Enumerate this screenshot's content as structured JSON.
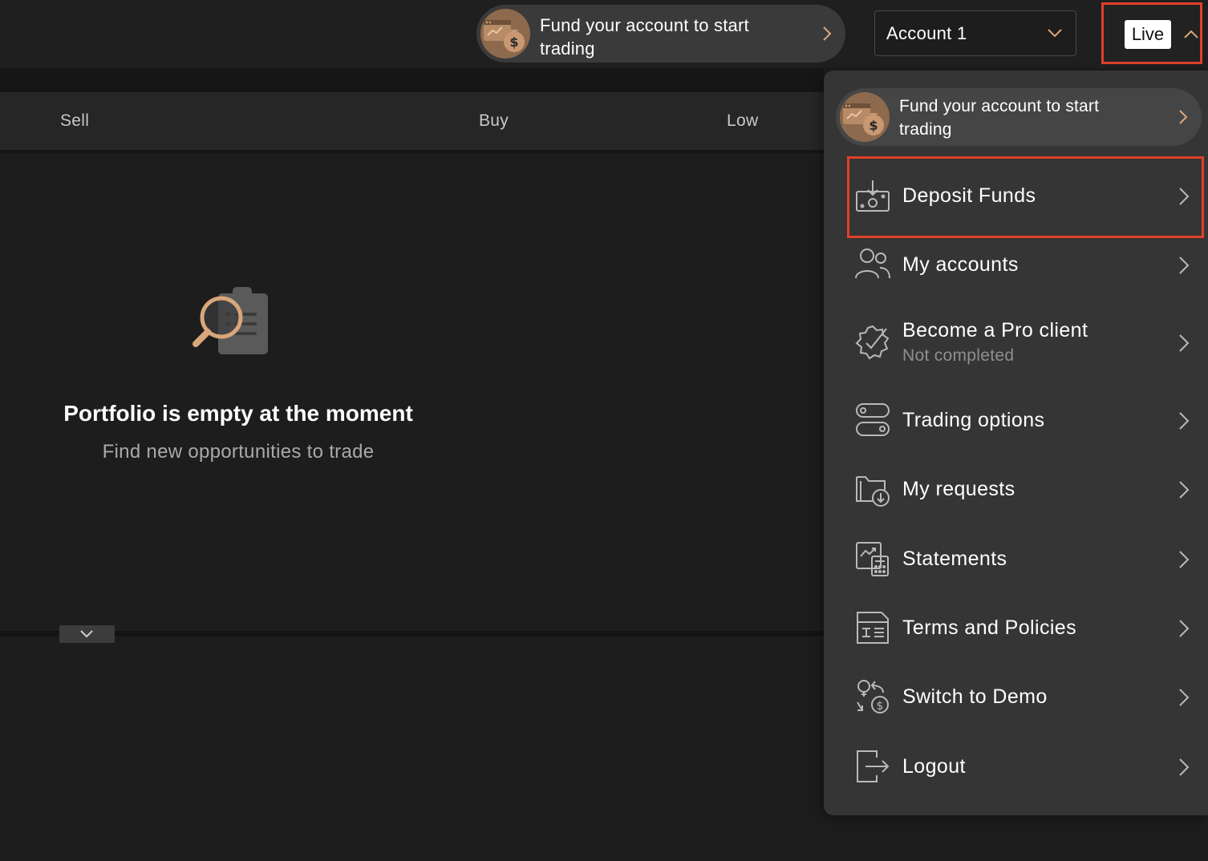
{
  "topbar": {
    "fund_banner": {
      "text": "Fund your account to start trading",
      "icon": "money-bag-icon"
    },
    "account_select": {
      "value": "Account 1"
    },
    "mode_toggle": {
      "label": "Live"
    }
  },
  "portfolio": {
    "columns": [
      "Sell",
      "Buy",
      "Low"
    ],
    "empty_title": "Portfolio is empty at the moment",
    "empty_subtitle": "Find new opportunities to trade",
    "empty_icon": "search-document-icon"
  },
  "menu": {
    "fund_banner": {
      "text": "Fund your account to start trading"
    },
    "items": [
      {
        "label": "Deposit Funds",
        "icon": "deposit-icon"
      },
      {
        "label": "My accounts",
        "icon": "users-icon"
      },
      {
        "label": "Become a Pro client",
        "sublabel": "Not completed",
        "icon": "badge-check-icon"
      },
      {
        "label": "Trading options",
        "icon": "toggles-icon"
      },
      {
        "label": "My requests",
        "icon": "folder-download-icon"
      },
      {
        "label": "Statements",
        "icon": "statement-icon"
      },
      {
        "label": "Terms and Policies",
        "icon": "document-text-icon"
      },
      {
        "label": "Switch to Demo",
        "icon": "switch-demo-icon"
      },
      {
        "label": "Logout",
        "icon": "logout-icon"
      }
    ]
  },
  "colors": {
    "accent": "#e0402a",
    "background": "#1d1d1d",
    "menu_background": "#353535",
    "pill_background": "#3a3a3a",
    "fund_accent": "#d9a77c"
  }
}
